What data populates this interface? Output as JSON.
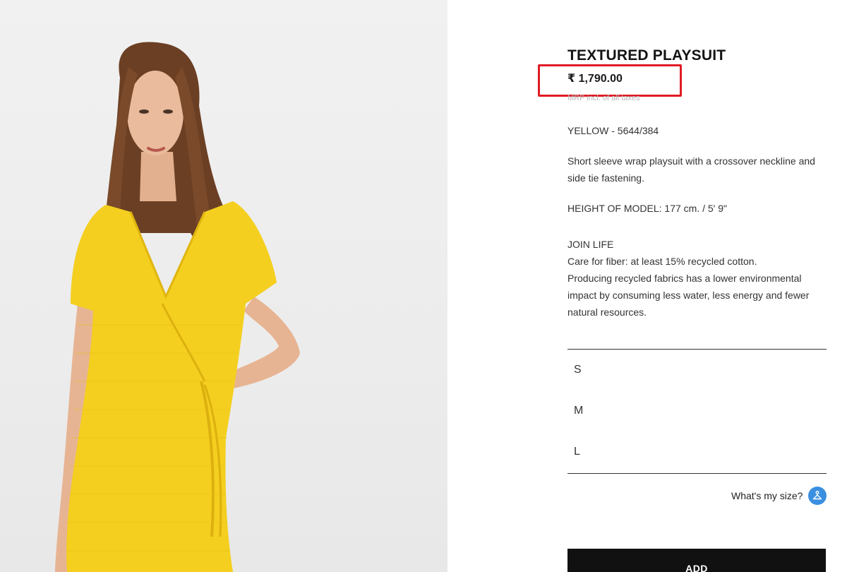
{
  "product": {
    "title": "TEXTURED PLAYSUIT",
    "price": "₹ 1,790.00",
    "tax_note": "MRP incl. of all taxes",
    "color_ref": "YELLOW - 5644/384",
    "description": "Short sleeve wrap playsuit with a crossover neckline and side tie fastening.",
    "model_height": "HEIGHT OF MODEL: 177 cm. / 5' 9\"",
    "join_life": {
      "heading": "JOIN LIFE",
      "line1": "Care for fiber: at least 15% recycled cotton.",
      "line2": "Producing recycled fabrics has a lower environmental impact by consuming less water, less energy and fewer natural resources."
    }
  },
  "sizes": [
    "S",
    "M",
    "L"
  ],
  "size_guide": {
    "label": "What's my size?",
    "icon": "hanger-icon"
  },
  "add_button": {
    "label": "ADD"
  },
  "image": {
    "description_icon": "model-photo",
    "garment_color": "#f4cf1f"
  },
  "colors": {
    "highlight": "#e01b24",
    "accent": "#3a8fe0",
    "button": "#111111"
  }
}
